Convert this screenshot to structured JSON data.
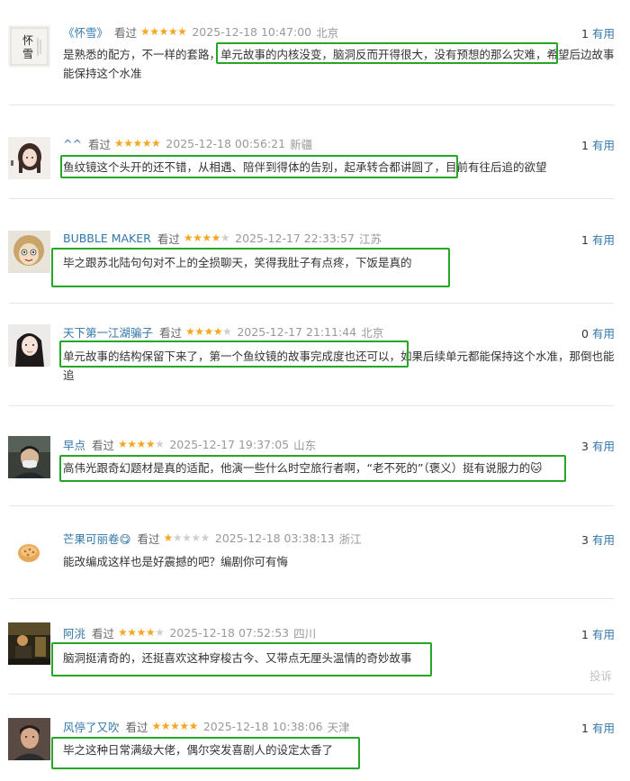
{
  "comments": [
    {
      "name": "《怀雪》",
      "seen": "看过",
      "rating": 5,
      "time": "2025-12-18 10:47:00",
      "location": "北京",
      "useful_count": "1",
      "useful_label": "有用",
      "text": "是熟悉的配方，不一样的套路，单元故事的内核没变，脑洞反而开得很大，没有预想的那么灾难，希望后边故事能保持这个水准",
      "avatar": "calligraphy-avatar"
    },
    {
      "name": "^^",
      "seen": "看过",
      "rating": 5,
      "time": "2025-12-18 00:56:21",
      "location": "新疆",
      "useful_count": "1",
      "useful_label": "有用",
      "text": "鱼纹镜这个头开的还不错，从相遇、陪伴到得体的告别，起承转合都讲圆了，目前有往后追的欲望",
      "avatar": "anime-girl-avatar"
    },
    {
      "name": "BUBBLE MAKER",
      "seen": "看过",
      "rating": 4,
      "time": "2025-12-17 22:33:57",
      "location": "江苏",
      "useful_count": "1",
      "useful_label": "有用",
      "text": "毕之跟苏北陆句句对不上的全损聊天，笑得我肚子有点疼，下饭是真的",
      "avatar": "cartoon-face-avatar"
    },
    {
      "name": "天下第一江湖骗子",
      "seen": "看过",
      "rating": 4,
      "time": "2025-12-17 21:11:44",
      "location": "北京",
      "useful_count": "0",
      "useful_label": "有用",
      "text": "单元故事的结构保留下来了，第一个鱼纹镜的故事完成度也还可以，如果后续单元都能保持这个水准，那倒也能追",
      "avatar": "girl-portrait-avatar"
    },
    {
      "name": "早点",
      "seen": "看过",
      "rating": 4,
      "time": "2025-12-17 19:37:05",
      "location": "山东",
      "useful_count": "3",
      "useful_label": "有用",
      "text": "高伟光跟奇幻题材是真的适配，他演一些什么时空旅行者啊，“老不死的”（褒义）挺有说服力的🐱",
      "avatar": "masked-man-avatar"
    },
    {
      "name": "芒果可丽卷😋",
      "seen": "看过",
      "rating": 1,
      "time": "2025-12-18 03:38:13",
      "location": "浙江",
      "useful_count": "3",
      "useful_label": "有用",
      "text": "能改编成这样也是好震撼的吧？编剧你可有悔",
      "avatar": "pastry-avatar"
    },
    {
      "name": "阿洮",
      "seen": "看过",
      "rating": 4,
      "time": "2025-12-18 07:52:53",
      "location": "四川",
      "useful_count": "1",
      "useful_label": "有用",
      "text": "脑洞挺清奇的，还挺喜欢这种穿梭古今、又带点无厘头温情的奇妙故事",
      "avatar": "dark-scene-avatar"
    },
    {
      "name": "风停了又吹",
      "seen": "看过",
      "rating": 5,
      "time": "2025-12-18 10:38:06",
      "location": "天津",
      "useful_count": "1",
      "useful_label": "有用",
      "text": "毕之这种日常满级大佬，偶尔突发喜剧人的设定太香了",
      "avatar": "man-portrait-avatar"
    }
  ],
  "report_label": "投诉",
  "colors": {
    "name": "#3377aa",
    "star": "#f5a623",
    "highlight": "#25a626",
    "meta": "#999999"
  }
}
